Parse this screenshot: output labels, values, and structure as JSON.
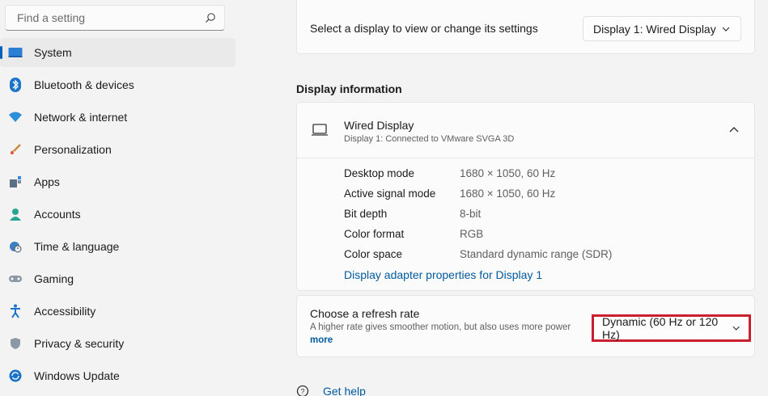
{
  "search": {
    "placeholder": "Find a setting"
  },
  "sidebar": {
    "items": [
      {
        "label": "System",
        "icon": "system-icon",
        "active": true
      },
      {
        "label": "Bluetooth & devices",
        "icon": "bluetooth-icon"
      },
      {
        "label": "Network & internet",
        "icon": "wifi-icon"
      },
      {
        "label": "Personalization",
        "icon": "brush-icon"
      },
      {
        "label": "Apps",
        "icon": "apps-icon"
      },
      {
        "label": "Accounts",
        "icon": "account-icon"
      },
      {
        "label": "Time & language",
        "icon": "globe-clock-icon"
      },
      {
        "label": "Gaming",
        "icon": "gamepad-icon"
      },
      {
        "label": "Accessibility",
        "icon": "accessibility-icon"
      },
      {
        "label": "Privacy & security",
        "icon": "shield-icon"
      },
      {
        "label": "Windows Update",
        "icon": "update-icon"
      }
    ]
  },
  "display_select": {
    "text": "Select a display to view or change its settings",
    "value": "Display 1: Wired Display"
  },
  "display_info": {
    "section_title": "Display information",
    "title": "Wired Display",
    "subtitle": "Display 1: Connected to VMware SVGA 3D",
    "rows": [
      {
        "key": "Desktop mode",
        "value": "1680 × 1050, 60 Hz"
      },
      {
        "key": "Active signal mode",
        "value": "1680 × 1050, 60 Hz"
      },
      {
        "key": "Bit depth",
        "value": "8-bit"
      },
      {
        "key": "Color format",
        "value": "RGB"
      },
      {
        "key": "Color space",
        "value": "Standard dynamic range (SDR)"
      }
    ],
    "link": "Display adapter properties for Display 1"
  },
  "refresh": {
    "title": "Choose a refresh rate",
    "description": "A higher rate gives smoother motion, but also uses more power",
    "more": "more",
    "value": "Dynamic (60 Hz or 120 Hz)"
  },
  "help": {
    "label": "Get help"
  },
  "colors": {
    "accent": "#005fb8",
    "highlight_border": "#c8202f",
    "link": "#005a9e"
  }
}
